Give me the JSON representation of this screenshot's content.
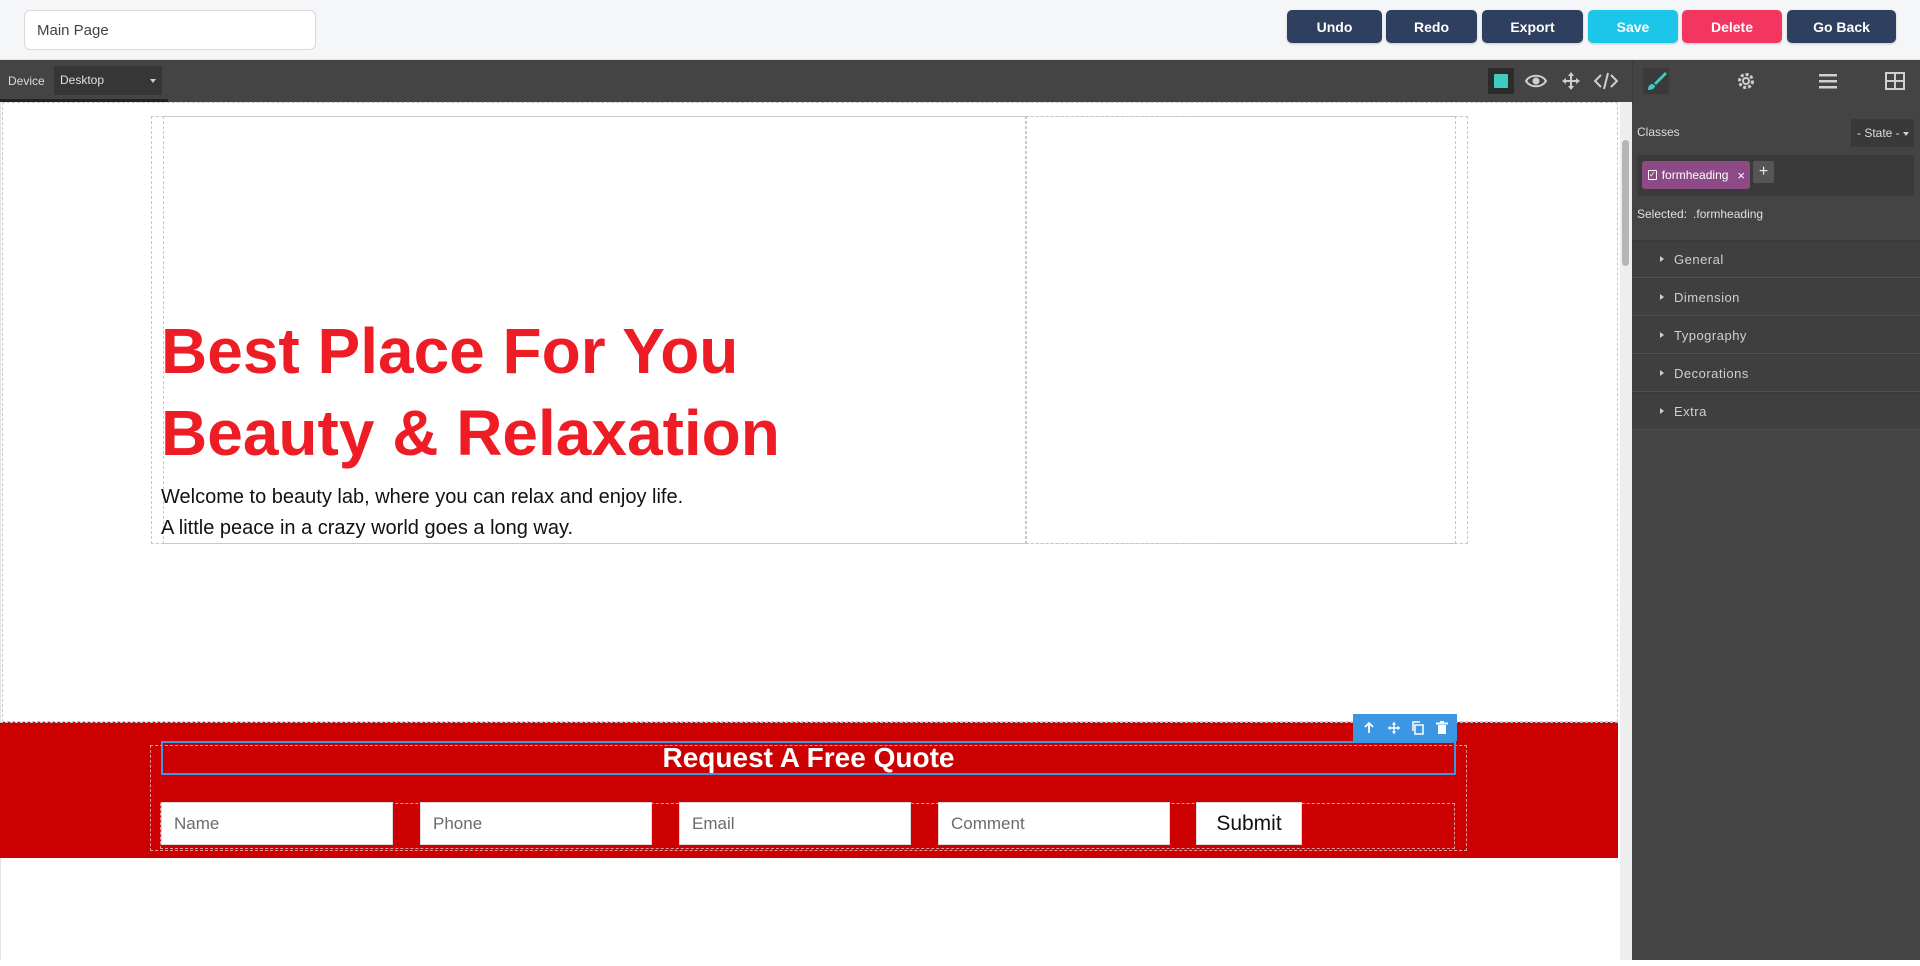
{
  "topbar": {
    "page_name": "Main Page",
    "buttons": [
      {
        "label": "Undo",
        "color": "#2f3f5f"
      },
      {
        "label": "Redo",
        "color": "#2f3f5f"
      },
      {
        "label": "Export",
        "color": "#2f3f5f"
      },
      {
        "label": "Save",
        "color": "#1cc6e8"
      },
      {
        "label": "Delete",
        "color": "#f2365f"
      },
      {
        "label": "Go Back",
        "color": "#2f3f5f"
      }
    ]
  },
  "editor": {
    "device_label": "Device",
    "device_value": "Desktop",
    "tools": [
      "sw-visibility-icon",
      "preview-eye-icon",
      "fullscreen-move-icon",
      "code-icon"
    ],
    "panel_tabs": [
      "style-manager-brush-icon",
      "settings-gear-icon",
      "layer-manager-icon",
      "blocks-icon"
    ],
    "accent_color": "#3fcbc0"
  },
  "canvas": {
    "hero": {
      "title_line1": "Best Place For You",
      "title_line2": "Beauty & Relaxation",
      "text_line1": "Welcome to beauty lab, where you can relax and enjoy life.",
      "text_line2": "A little peace in a crazy world goes a long way.",
      "title_color": "#ee1c24"
    },
    "quote": {
      "heading": "Request A Free Quote",
      "background": "#cc0000",
      "fields": [
        {
          "placeholder": "Name"
        },
        {
          "placeholder": "Phone"
        },
        {
          "placeholder": "Email"
        },
        {
          "placeholder": "Comment"
        }
      ],
      "submit_label": "Submit",
      "toolbar_icons": [
        "arrow-up-icon",
        "move-icon",
        "copy-icon",
        "trash-icon"
      ]
    }
  },
  "style_panel": {
    "classes_label": "Classes",
    "state_select": "- State -",
    "class_tag": "formheading",
    "selected_label": "Selected:",
    "selected_value": ".formheading",
    "sectors": [
      "General",
      "Dimension",
      "Typography",
      "Decorations",
      "Extra"
    ]
  }
}
